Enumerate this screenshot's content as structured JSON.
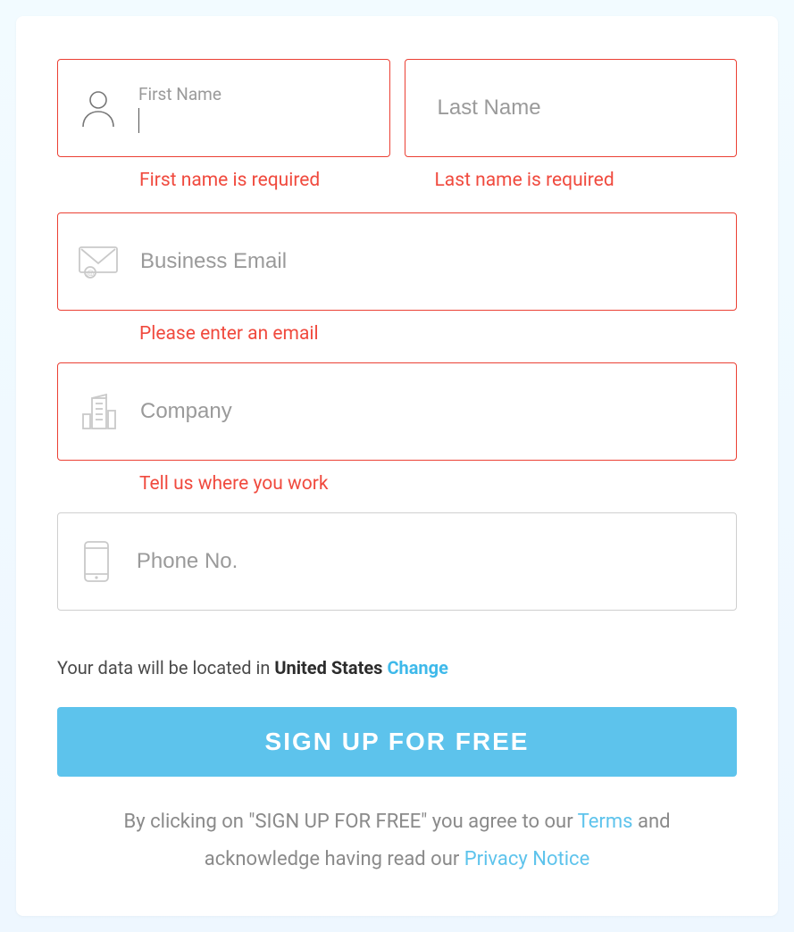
{
  "form": {
    "first_name": {
      "label": "First Name",
      "value": "",
      "error": "First name is required"
    },
    "last_name": {
      "placeholder": "Last Name",
      "value": "",
      "error": "Last name is required"
    },
    "email": {
      "placeholder": "Business Email",
      "value": "",
      "error": "Please enter an email"
    },
    "company": {
      "placeholder": "Company",
      "value": "",
      "error": "Tell us where you work"
    },
    "phone": {
      "placeholder": "Phone No.",
      "value": ""
    }
  },
  "location": {
    "prefix": "Your data will be located in ",
    "country": "United States",
    "change": "Change"
  },
  "submit_label": "SIGN UP FOR FREE",
  "legal": {
    "before_terms": "By clicking on \"SIGN UP FOR FREE\" you agree to our ",
    "terms": "Terms",
    "between": " and acknowledge having read our ",
    "privacy": "Privacy Notice"
  },
  "colors": {
    "error": "#eb4034",
    "accent": "#5dc3ec",
    "link": "#3eb9ea"
  }
}
